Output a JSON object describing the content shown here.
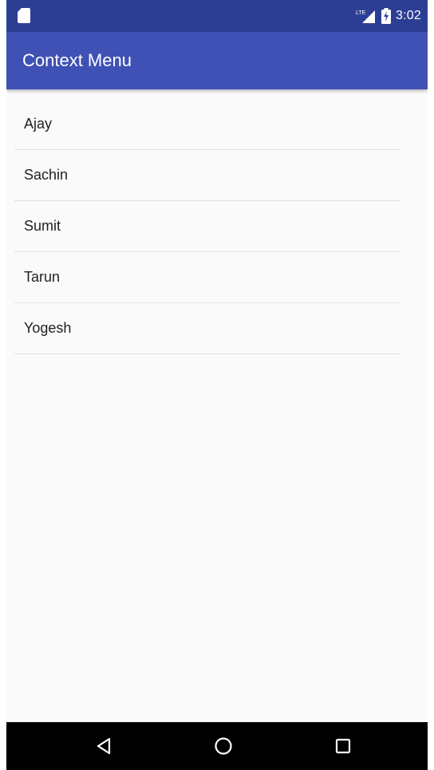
{
  "status_bar": {
    "time": "3:02",
    "network_label": "LTE",
    "left_icon": "sd-card-icon",
    "battery_icon": "battery-charging-icon",
    "signal_icon": "signal-icon"
  },
  "app_bar": {
    "title": "Context Menu"
  },
  "list": {
    "items": [
      {
        "label": "Ajay"
      },
      {
        "label": "Sachin"
      },
      {
        "label": "Sumit"
      },
      {
        "label": "Tarun"
      },
      {
        "label": "Yogesh"
      }
    ]
  },
  "nav_bar": {
    "back_icon": "back-triangle-icon",
    "home_icon": "home-circle-icon",
    "recents_icon": "recents-square-icon"
  },
  "colors": {
    "status_bar": "#2c3e94",
    "app_bar": "#3f51b5",
    "background": "#fafafa",
    "divider": "#e0e0e0",
    "nav_bar": "#000000"
  }
}
